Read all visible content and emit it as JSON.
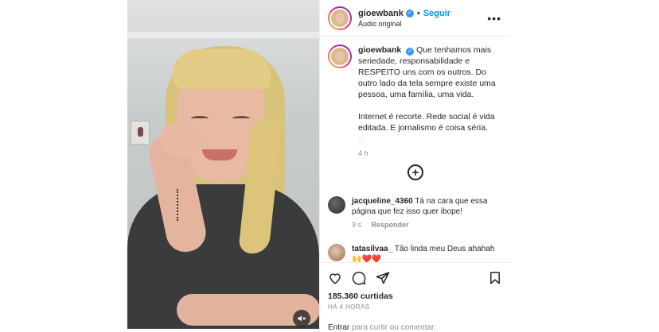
{
  "header": {
    "username": "gioewbank",
    "separator": "•",
    "follow_label": "Seguir",
    "audio_label": "Áudio original",
    "more_label": "•••"
  },
  "caption": {
    "username": "gioewbank",
    "paragraph1": "Que tenhamos mais seriedade, responsabilidade e RESPEITO uns com os outros. Do outro lado da tela sempre existe uma pessoa, uma família, uma vida.",
    "paragraph2": "Internet é recorte. Rede social é vida editada. E jornalismo é coisa séria.",
    "time": "4 h"
  },
  "comments": [
    {
      "username": "jacqueline_4360",
      "text": "Tá na cara que essa página que fez isso quer ibope!",
      "time": "9 s",
      "reply_label": "Responder"
    },
    {
      "username": "tatasilvaa_",
      "text": "Tão linda meu Deus ahahah",
      "emojis": "🙌❤️❤️"
    }
  ],
  "actions": {
    "likes": "185.360 curtidas",
    "posted_ago": "HÁ 4 HORAS",
    "login_link": "Entrar",
    "login_text": " para curtir ou comentar."
  },
  "icons": {
    "verified": "verified-badge-icon",
    "like": "heart-icon",
    "comment": "comment-bubble-icon",
    "share": "paper-plane-icon",
    "save": "bookmark-icon",
    "mute": "speaker-muted-icon",
    "add": "plus-circle-icon"
  },
  "colors": {
    "link_blue": "#0095f6",
    "verified_blue": "#3897f0",
    "text_primary": "#262626",
    "text_secondary": "#8e8e8e"
  }
}
